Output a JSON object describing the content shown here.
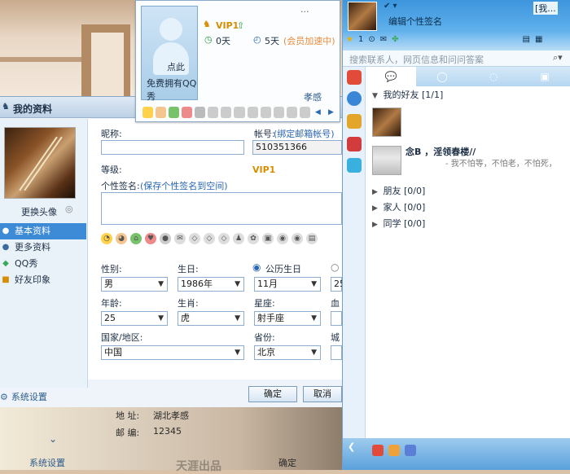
{
  "profile_window": {
    "title": "我的资料",
    "change_avatar": "更换头像",
    "nav": [
      "基本资料",
      "更多资料",
      "QQ秀",
      "好友印象"
    ],
    "settings": "系统设置",
    "nickname_label": "昵称:",
    "account_label": "帐号:",
    "account_link": "(绑定邮箱帐号)",
    "account_value": "510351366",
    "level_label": "等级:",
    "vip_badge": "VIP1",
    "signature_label": "个性签名:",
    "signature_link": "(保存个性签名到空间)",
    "gender_label": "性别:",
    "gender_value": "男",
    "birthday_label": "生日:",
    "birthday_value": "1986年",
    "calendar_label": "公历生日",
    "month_value": "11月",
    "day_value": "25",
    "age_label": "年龄:",
    "age_value": "25",
    "zodiac_label": "生肖:",
    "zodiac_value": "虎",
    "constellation_label": "星座:",
    "constellation_value": "射手座",
    "blood_label": "血型",
    "country_label": "国家/地区:",
    "country_value": "中国",
    "province_label": "省份:",
    "province_value": "北京",
    "city_label": "城市",
    "ok_button": "确定",
    "cancel_button": "取消"
  },
  "bottom_overlay": {
    "address_label": "地    址:",
    "address_value": "湖北孝感",
    "zip_label": "邮    编:",
    "zip_value": "12345",
    "ok": "确定",
    "settings": "系统设置",
    "watermark": "天涯出品"
  },
  "mini_card": {
    "pic_label1": "点此",
    "pic_label2": "免费拥有QQ秀",
    "more": "...",
    "vip": "VIP1",
    "days1": "0天",
    "days2": "5天",
    "speedup": "(会员加速中)",
    "city": "孝感"
  },
  "qq_panel": {
    "nickname": "[我...",
    "signature": "编辑个性签名",
    "count": "1",
    "search_placeholder": "搜索联系人，网页信息和问问答案",
    "groups": [
      {
        "name": "我的好友",
        "count": "[1/1]"
      },
      {
        "name": "朋友",
        "count": "[0/0]"
      },
      {
        "name": "家人",
        "count": "[0/0]"
      },
      {
        "name": "同学",
        "count": "[0/0]"
      }
    ],
    "friend2_name": "念B ，淫领春楼//",
    "friend2_sig": "- 我不怕等，不怕老，不怕死，"
  },
  "colors": {
    "accent_blue": "#3d8ad6",
    "qq_header": "#3d95dc",
    "vip_orange": "#d88d00"
  }
}
